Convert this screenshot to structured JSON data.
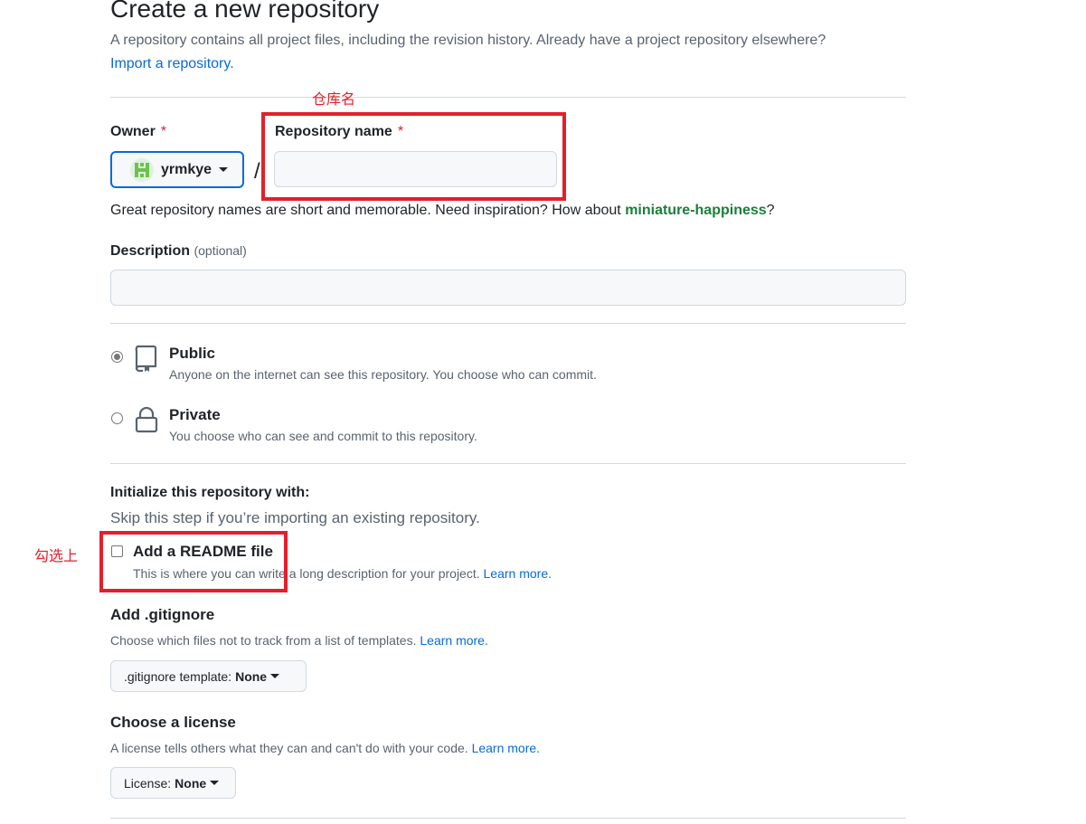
{
  "header": {
    "title": "Create a new repository",
    "subtitle": "A repository contains all project files, including the revision history. Already have a project repository elsewhere?",
    "import_link": "Import a repository."
  },
  "annotations": {
    "repo_name_note": "仓库名",
    "readme_note": "勾选上",
    "color": "#e3202a"
  },
  "owner": {
    "label": "Owner",
    "required_mark": "*",
    "value": "yrmkye"
  },
  "repo_name": {
    "label": "Repository name",
    "required_mark": "*",
    "value": "",
    "placeholder": ""
  },
  "name_hint": {
    "text": "Great repository names are short and memorable. Need inspiration? How about",
    "suggestion": "miniature-happiness",
    "end": "?"
  },
  "description": {
    "label": "Description",
    "optional": "(optional)",
    "value": ""
  },
  "visibility": {
    "public": {
      "title": "Public",
      "desc": "Anyone on the internet can see this repository. You choose who can commit.",
      "selected": true,
      "icon": "repo-icon"
    },
    "private": {
      "title": "Private",
      "desc": "You choose who can see and commit to this repository.",
      "selected": false,
      "icon": "lock-icon"
    }
  },
  "initialize": {
    "title": "Initialize this repository with:",
    "subtitle": "Skip this step if you’re importing an existing repository.",
    "readme": {
      "label": "Add a README file",
      "desc": "This is where you can write a long description for your project.",
      "learn_more": "Learn more.",
      "checked": false
    }
  },
  "gitignore": {
    "title": "Add .gitignore",
    "desc": "Choose which files not to track from a list of templates.",
    "learn_more": "Learn more.",
    "button_prefix": ".gitignore template:",
    "button_value": "None"
  },
  "license": {
    "title": "Choose a license",
    "desc": "A license tells others what they can and can't do with your code.",
    "learn_more": "Learn more.",
    "button_prefix": "License:",
    "button_value": "None"
  }
}
